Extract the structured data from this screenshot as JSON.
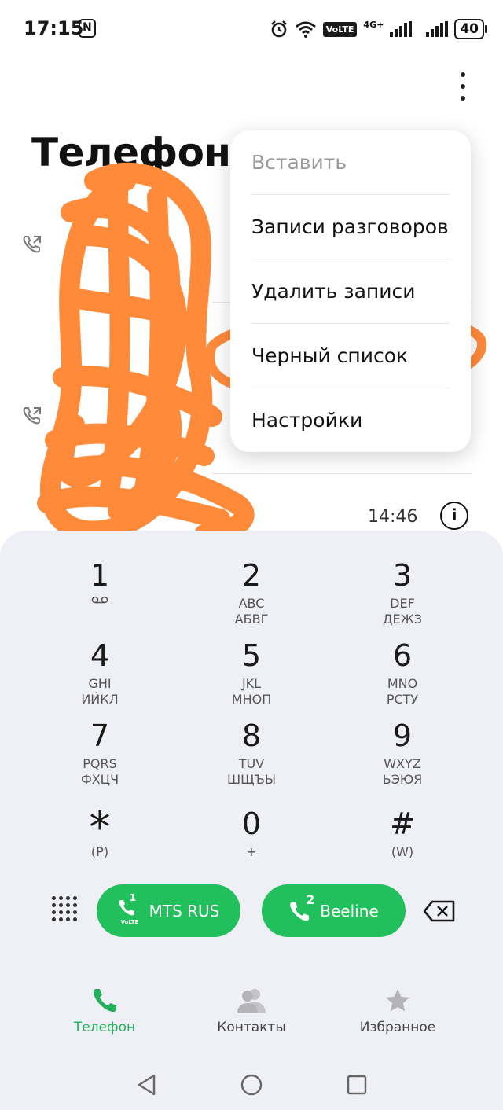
{
  "status_bar": {
    "time": "17:15",
    "nfc_label": "N",
    "volte": "VoLTE",
    "network": "4G+",
    "battery": "40"
  },
  "header": {
    "title": "Телефон"
  },
  "call_list": {
    "last_call_time": "14:46"
  },
  "menu": {
    "items": [
      {
        "label": "Вставить",
        "enabled": false
      },
      {
        "label": "Записи разговоров",
        "enabled": true
      },
      {
        "label": "Удалить записи",
        "enabled": true
      },
      {
        "label": "Черный список",
        "enabled": true
      },
      {
        "label": "Настройки",
        "enabled": true
      }
    ]
  },
  "dialpad": {
    "keys": [
      {
        "digit": "1",
        "l1": "",
        "l2": ""
      },
      {
        "digit": "2",
        "l1": "ABC",
        "l2": "АБВГ"
      },
      {
        "digit": "3",
        "l1": "DEF",
        "l2": "ДЕЖЗ"
      },
      {
        "digit": "4",
        "l1": "GHI",
        "l2": "ИЙКЛ"
      },
      {
        "digit": "5",
        "l1": "JKL",
        "l2": "МНОП"
      },
      {
        "digit": "6",
        "l1": "MNO",
        "l2": "РСТУ"
      },
      {
        "digit": "7",
        "l1": "PQRS",
        "l2": "ФХЦЧ"
      },
      {
        "digit": "8",
        "l1": "TUV",
        "l2": "ШЩЪЫ"
      },
      {
        "digit": "9",
        "l1": "WXYZ",
        "l2": "ЬЭЮЯ"
      },
      {
        "digit": "*",
        "l1": "(P)",
        "l2": ""
      },
      {
        "digit": "0",
        "l1": "+",
        "l2": ""
      },
      {
        "digit": "#",
        "l1": "(W)",
        "l2": ""
      }
    ]
  },
  "call_buttons": {
    "sim1": {
      "slot": "1",
      "tag": "VoLTE",
      "label": "MTS RUS"
    },
    "sim2": {
      "slot": "2",
      "label": "Beeline"
    }
  },
  "bottom_nav": {
    "items": [
      {
        "label": "Телефон",
        "active": true
      },
      {
        "label": "Контакты",
        "active": false
      },
      {
        "label": "Избранное",
        "active": false
      }
    ]
  },
  "colors": {
    "accent": "#22c05c",
    "nav_active": "#22b05a",
    "dialpad_bg": "#eff0f5",
    "scribble": "#ff8a3a"
  },
  "icons": {
    "more": "more-vertical-icon",
    "call_history": "outgoing-call-icon",
    "info": "info-icon",
    "voicemail": "voicemail-icon",
    "grid": "dialpad-grid-icon",
    "backspace": "backspace-icon",
    "phone": "phone-icon",
    "contacts": "contacts-icon",
    "favorites": "star-icon"
  }
}
